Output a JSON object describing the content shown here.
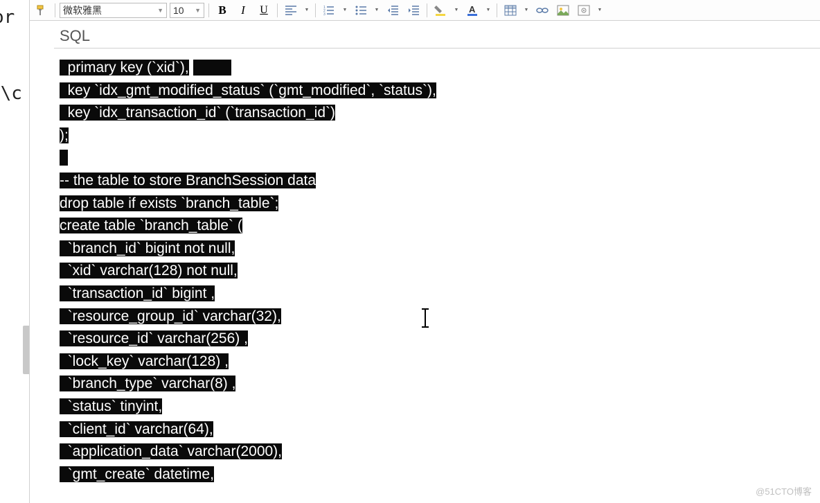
{
  "left_panel": {
    "t1": "or",
    "t2": "a\\c"
  },
  "toolbar": {
    "font_name": "微软雅黑",
    "font_size": "10",
    "bold": "B",
    "italic": "I",
    "underline": "U"
  },
  "tab": {
    "label": "SQL"
  },
  "code": {
    "lines": [
      "  primary key (`xid`),",
      "  key `idx_gmt_modified_status` (`gmt_modified`, `status`),",
      "  key `idx_transaction_id` (`transaction_id`)",
      ");",
      "",
      "-- the table to store BranchSession data",
      "drop table if exists `branch_table`;",
      "create table `branch_table` (",
      "  `branch_id` bigint not null,",
      "  `xid` varchar(128) not null,",
      "  `transaction_id` bigint ,",
      "  `resource_group_id` varchar(32),",
      "  `resource_id` varchar(256) ,",
      "  `lock_key` varchar(128) ,",
      "  `branch_type` varchar(8) ,",
      "  `status` tinyint,",
      "  `client_id` varchar(64),",
      "  `application_data` varchar(2000),",
      "  `gmt_create` datetime,"
    ]
  },
  "watermark": "@51CTO博客"
}
